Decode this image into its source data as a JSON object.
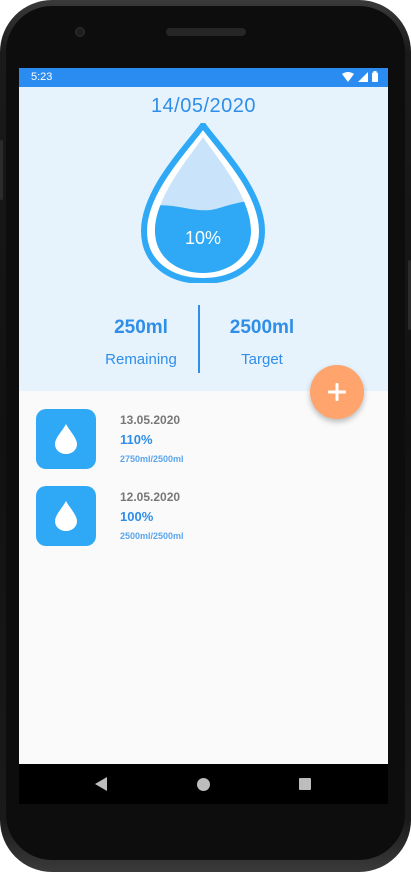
{
  "status": {
    "time": "5:23"
  },
  "header": {
    "date": "14/05/2020",
    "percent": "10%",
    "fill_fraction": 0.1,
    "remaining_value": "250ml",
    "remaining_label": "Remaining",
    "target_value": "2500ml",
    "target_label": "Target"
  },
  "history": [
    {
      "date": "13.05.2020",
      "percent": "110%",
      "amount": "2750ml/2500ml"
    },
    {
      "date": "12.05.2020",
      "percent": "100%",
      "amount": "2500ml/2500ml"
    }
  ],
  "colors": {
    "accent": "#2f8ee8",
    "fab": "#ffa46d",
    "tile": "#2fa9f5",
    "header_bg": "#e6f3fc"
  },
  "icons": {
    "fab": "plus-icon",
    "history": "water-drop-icon"
  }
}
